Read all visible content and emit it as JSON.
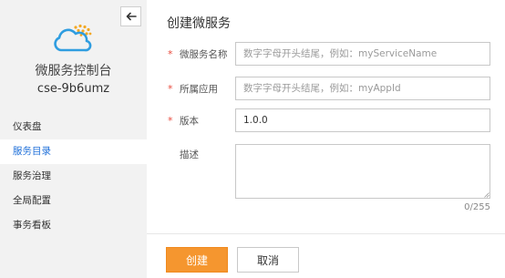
{
  "sidebar": {
    "back_icon": "arrow-left-icon",
    "logo_icon": "cloud-logo-icon",
    "console_title": "微服务控制台",
    "instance_name": "cse-9b6umz",
    "items": [
      {
        "label": "仪表盘",
        "active": false
      },
      {
        "label": "服务目录",
        "active": true
      },
      {
        "label": "服务治理",
        "active": false
      },
      {
        "label": "全局配置",
        "active": false
      },
      {
        "label": "事务看板",
        "active": false
      }
    ]
  },
  "form": {
    "title": "创建微服务",
    "required_mark": "*",
    "service_name": {
      "label": "微服务名称",
      "placeholder": "数字字母开头结尾，例如：myServiceName",
      "value": ""
    },
    "app": {
      "label": "所属应用",
      "placeholder": "数字字母开头结尾，例如：myAppId",
      "value": ""
    },
    "version": {
      "label": "版本",
      "value": "1.0.0"
    },
    "description": {
      "label": "描述",
      "value": "",
      "counter": "0/255"
    },
    "create_label": "创建",
    "cancel_label": "取消"
  },
  "colors": {
    "accent": "#f5962f",
    "active_nav": "#1e6fd9",
    "required": "#e84a3c",
    "sidebar_bg": "#f2f2f2"
  }
}
